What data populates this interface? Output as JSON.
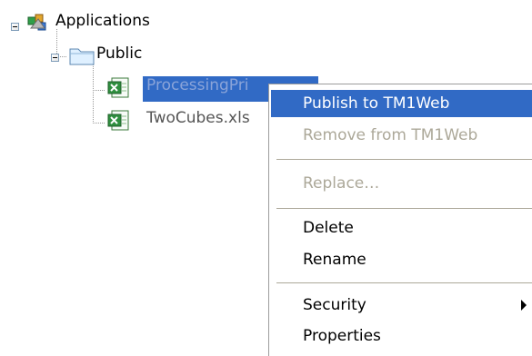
{
  "tree": {
    "root": {
      "label": "Applications",
      "icon": "applications-icon",
      "expanded": true
    },
    "public": {
      "label": "Public",
      "icon": "folder-icon",
      "expanded": true
    },
    "files": [
      {
        "label": "ProcessingPri",
        "icon": "excel-file-icon",
        "selected": true
      },
      {
        "label": "TwoCubes.xls",
        "icon": "excel-file-icon",
        "selected": false
      }
    ]
  },
  "context_menu": {
    "items": [
      {
        "label": "Publish to TM1Web",
        "state": "highlighted"
      },
      {
        "label": "Remove from TM1Web",
        "state": "disabled"
      },
      {
        "label": "Replace…",
        "state": "disabled"
      },
      {
        "label": "Delete",
        "state": "enabled"
      },
      {
        "label": "Rename",
        "state": "enabled"
      },
      {
        "label": "Security",
        "state": "enabled",
        "has_submenu": true
      },
      {
        "label": "Properties",
        "state": "enabled"
      }
    ]
  },
  "colors": {
    "selection": "#316ac5",
    "disabled_text": "#aca899",
    "menu_border": "#9c9c9c",
    "separator": "#aca899"
  }
}
